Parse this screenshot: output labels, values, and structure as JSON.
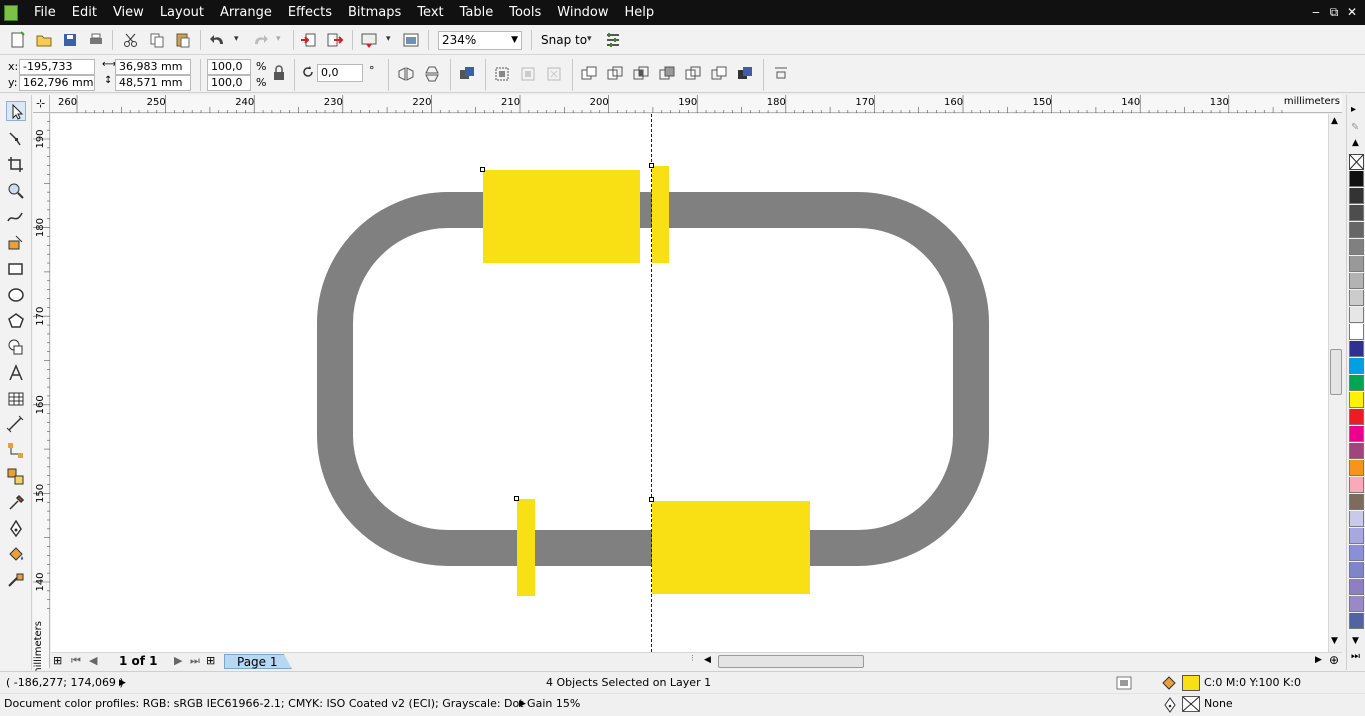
{
  "menu": [
    "File",
    "Edit",
    "View",
    "Layout",
    "Arrange",
    "Effects",
    "Bitmaps",
    "Text",
    "Table",
    "Tools",
    "Window",
    "Help"
  ],
  "window_controls": [
    "‒",
    "⧉",
    "✕"
  ],
  "toolbar": {
    "zoom_value": "234%",
    "snap_label": "Snap to"
  },
  "property_bar": {
    "x_label": "x:",
    "y_label": "y:",
    "x_value": "-195,733 mm",
    "y_value": "162,796 mm",
    "width_value": "36,983 mm",
    "height_value": "48,571 mm",
    "scale_x": "100,0",
    "scale_y": "100,0",
    "percent": "%",
    "rotation": "0,0",
    "degree": "°"
  },
  "rulers": {
    "units": "millimeters",
    "h_ticks": [
      "260",
      "250",
      "240",
      "230",
      "220",
      "210",
      "200",
      "190",
      "180",
      "170",
      "160",
      "150",
      "140",
      "130"
    ],
    "v_ticks": [
      "190",
      "180",
      "170",
      "160",
      "150",
      "140"
    ]
  },
  "page_nav": {
    "count": "1 of 1",
    "tab": "Page 1"
  },
  "status": {
    "cursor_pos": "( -186,277; 174,069 )",
    "selection": "4 Objects Selected on Layer 1",
    "fill_info": "C:0 M:0 Y:100 K:0",
    "outline_info": "None",
    "color_profiles": "Document color profiles: RGB: sRGB IEC61966-2.1; CMYK: ISO Coated v2 (ECI); Grayscale: Dot Gain 15%"
  },
  "colors": {
    "track": "#808080",
    "yellow": "#f9e015",
    "palette": [
      "#111111",
      "#333333",
      "#4d4d4d",
      "#666666",
      "#808080",
      "#999999",
      "#b3b3b3",
      "#cccccc",
      "#e6e6e6",
      "#ffffff",
      "#2e3192",
      "#00a0e3",
      "#00a651",
      "#fff200",
      "#ed1c24",
      "#ec008c",
      "#a0457e",
      "#f7941d",
      "#f9a9b7",
      "#7d6b5c",
      "#c9c9ec",
      "#a8a8e0",
      "#8a8fd6",
      "#7f86c8",
      "#8e7fc0",
      "#9a88c7",
      "#4f64a0"
    ]
  }
}
